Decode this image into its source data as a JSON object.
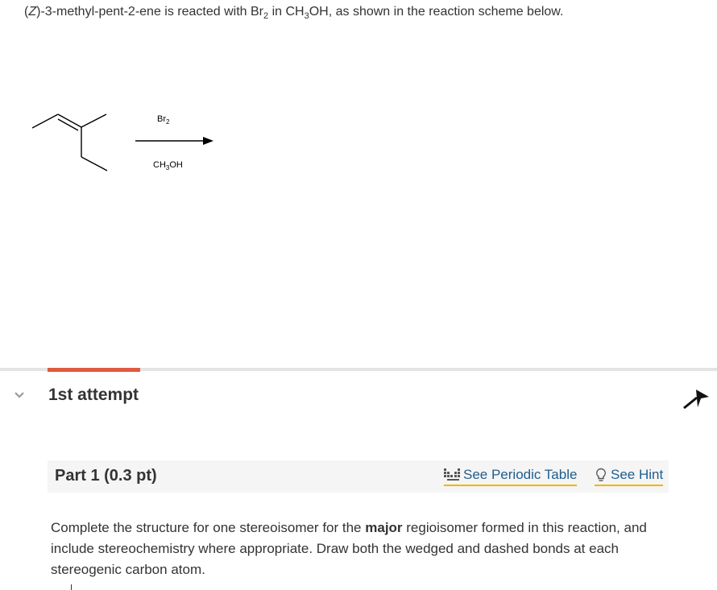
{
  "question": {
    "stereo_descriptor": "Z",
    "text_part1": "-3-methyl-pent-2-ene is reacted with Br",
    "sub1": "2",
    "text_part2": " in CH",
    "sub2": "3",
    "text_part3": "OH, as shown in the reaction scheme below."
  },
  "scheme": {
    "reagent_top_main": "Br",
    "reagent_top_sub": "2",
    "reagent_bottom_main1": "CH",
    "reagent_bottom_sub": "3",
    "reagent_bottom_main2": "OH"
  },
  "attempt": {
    "title": "1st attempt",
    "accent_color": "#e05a3f"
  },
  "part": {
    "title": "Part 1 (0.3 pt)",
    "periodic_table_label": "See Periodic Table",
    "hint_label": "See Hint",
    "link_color": "#1f5e8e",
    "underline_color": "#f0b400"
  },
  "instructions": {
    "before_bold": "Complete the structure for one stereoisomer for the ",
    "bold": "major",
    "after_bold": " regioisomer formed in this reaction, and include stereochemistry where appropriate. Draw both the wedged and dashed bonds at each stereogenic carbon atom."
  },
  "icons": {
    "collapse": "chevron-down-icon",
    "pin": "pin-icon",
    "periodic": "periodic-table-icon",
    "hint": "lightbulb-icon"
  }
}
